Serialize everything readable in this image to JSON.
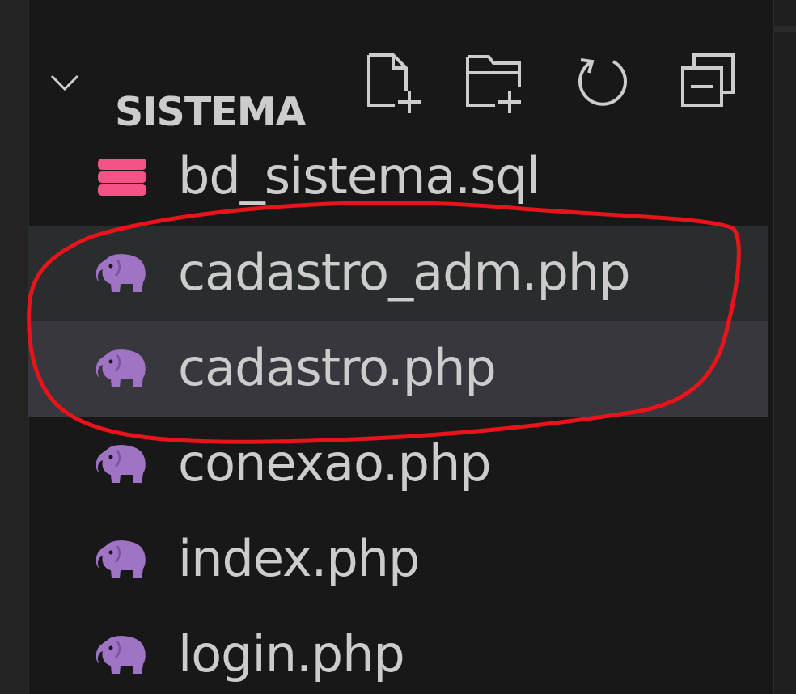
{
  "explorer": {
    "section_title": "SISTEMA",
    "actions": [
      {
        "name": "new-file-icon",
        "label": "New File"
      },
      {
        "name": "new-folder-icon",
        "label": "New Folder"
      },
      {
        "name": "refresh-icon",
        "label": "Refresh Explorer"
      },
      {
        "name": "collapse-all-icon",
        "label": "Collapse Folders in Explorer"
      }
    ],
    "files": [
      {
        "name": "bd_sistema.sql",
        "icon": "database-icon",
        "state": "normal"
      },
      {
        "name": "cadastro_adm.php",
        "icon": "php-elephant-icon",
        "state": "selected"
      },
      {
        "name": "cadastro.php",
        "icon": "php-elephant-icon",
        "state": "hover"
      },
      {
        "name": "conexao.php",
        "icon": "php-elephant-icon",
        "state": "normal"
      },
      {
        "name": "index.php",
        "icon": "php-elephant-icon",
        "state": "normal"
      },
      {
        "name": "login.php",
        "icon": "php-elephant-icon",
        "state": "normal"
      }
    ]
  },
  "colors": {
    "background": "#181818",
    "text": "#cccccc",
    "selected_row": "#2a2d2e",
    "hover_row": "#37373d",
    "php_icon": "#a074c4",
    "sql_icon": "#f55385",
    "annotation": "#e8131b"
  }
}
